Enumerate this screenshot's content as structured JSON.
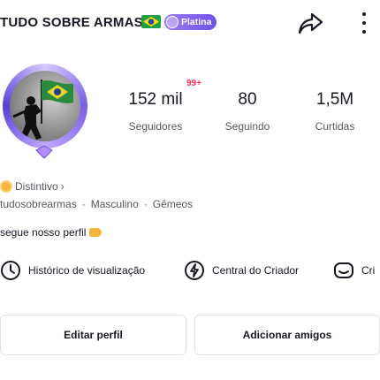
{
  "header": {
    "username_title": "TUDO SOBRE ARMAS",
    "tier_badge": "Platina",
    "share_icon": "share-arrow-icon",
    "more_icon": "more-vertical-icon"
  },
  "profile": {
    "notification_badge": "99+",
    "stats": [
      {
        "value": "152 mil",
        "label": "Seguidores"
      },
      {
        "value": "80",
        "label": "Seguindo"
      },
      {
        "value": "1,5M",
        "label": "Curtidas"
      }
    ],
    "distintivo": "Distintivo",
    "handle": "tudosobrearmas",
    "gender": "Masculino",
    "sign": "Gêmeos",
    "bio": "segue nosso perfil"
  },
  "tools": [
    {
      "label": "Histórico de visualização",
      "icon": "history-clock-icon"
    },
    {
      "label": "Central do Criador",
      "icon": "lightning-icon"
    },
    {
      "label": "Cri",
      "icon": "create-icon"
    }
  ],
  "actions": {
    "edit_profile": "Editar perfil",
    "add_friends": "Adicionar amigos"
  },
  "colors": {
    "accent_red": "#fe2c55",
    "tier_purple": "#7a5ce8",
    "text_primary": "#161823",
    "text_secondary": "#57585e"
  }
}
